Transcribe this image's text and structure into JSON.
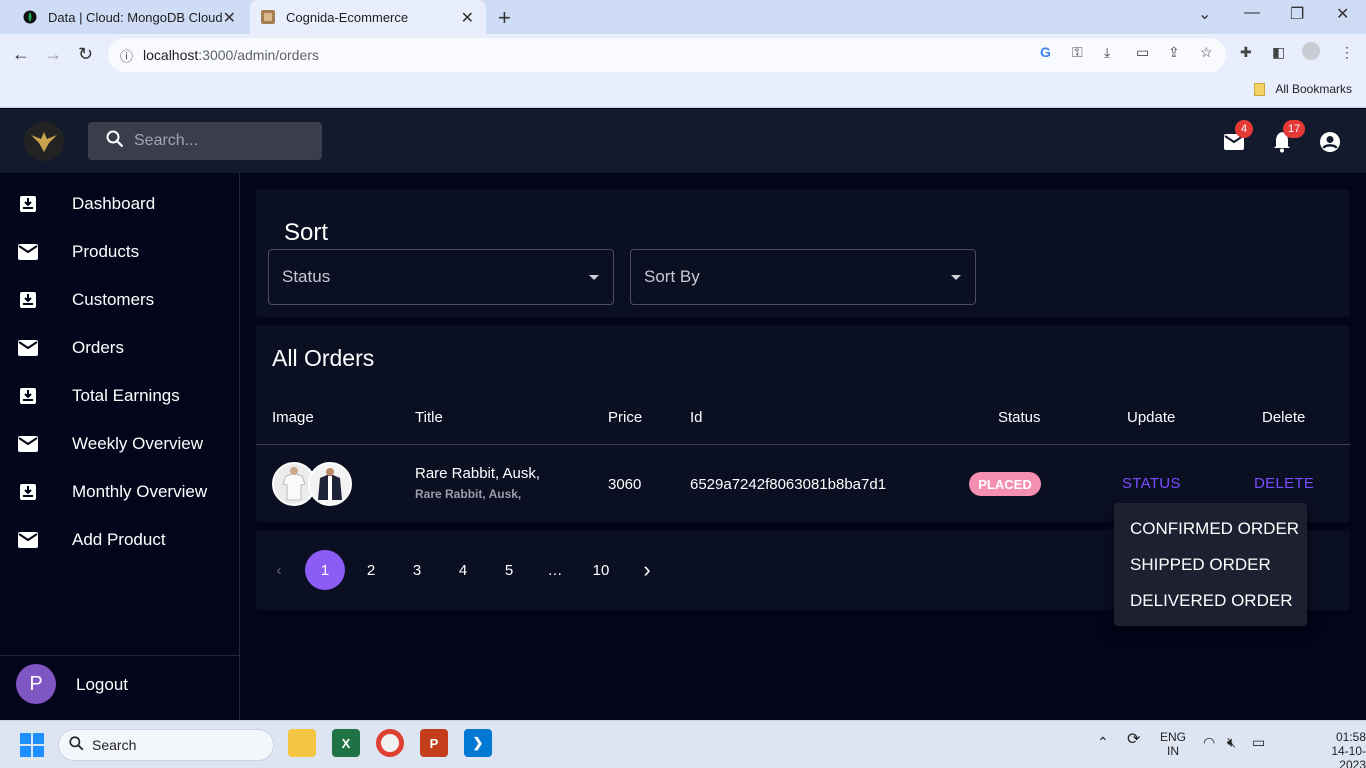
{
  "browser": {
    "tabs": [
      {
        "title": "Data | Cloud: MongoDB Cloud",
        "icon": "mongodb-leaf-icon"
      },
      {
        "title": "Cognida-Ecommerce",
        "icon": "site-favicon"
      }
    ],
    "url_domain": "localhost",
    "url_path": ":3000/admin/orders",
    "bookmarks_label": "All Bookmarks"
  },
  "header": {
    "search_placeholder": "Search...",
    "mail_badge": "4",
    "notification_badge": "17"
  },
  "sidebar": {
    "items": [
      {
        "label": "Dashboard",
        "icon": "inbox-icon"
      },
      {
        "label": "Products",
        "icon": "mail-icon"
      },
      {
        "label": "Customers",
        "icon": "inbox-icon"
      },
      {
        "label": "Orders",
        "icon": "mail-icon"
      },
      {
        "label": "Total Earnings",
        "icon": "inbox-icon"
      },
      {
        "label": "Weekly Overview",
        "icon": "mail-icon"
      },
      {
        "label": "Monthly Overview",
        "icon": "inbox-icon"
      },
      {
        "label": "Add Product",
        "icon": "mail-icon"
      }
    ],
    "avatar_letter": "P",
    "logout_label": "Logout"
  },
  "sort": {
    "title": "Sort",
    "status_label": "Status",
    "sortby_label": "Sort By"
  },
  "orders": {
    "title": "All Orders",
    "columns": [
      "Image",
      "Title",
      "Price",
      "Id",
      "Status",
      "Update",
      "Delete"
    ],
    "rows": [
      {
        "title": "Rare Rabbit, Ausk,",
        "subtitle": "Rare Rabbit, Ausk,",
        "price": "3060",
        "id": "6529a7242f8063081b8ba7d1",
        "status": "PLACED",
        "update_label": "STATUS",
        "delete_label": "DELETE"
      }
    ]
  },
  "pagination": {
    "pages": [
      "1",
      "2",
      "3",
      "4",
      "5",
      "…",
      "10"
    ],
    "selected": "1"
  },
  "status_menu": {
    "options": [
      "CONFIRMED ORDER",
      "SHIPPED ORDER",
      "DELIVERED ORDER"
    ]
  },
  "taskbar": {
    "search_label": "Search",
    "lang_line1": "ENG",
    "lang_line2": "IN",
    "time": "01:58",
    "date": "14-10-2023"
  },
  "colors": {
    "accent": "#8b5cf6",
    "status_chip": "#f48fb1",
    "link": "#7c4dff"
  }
}
